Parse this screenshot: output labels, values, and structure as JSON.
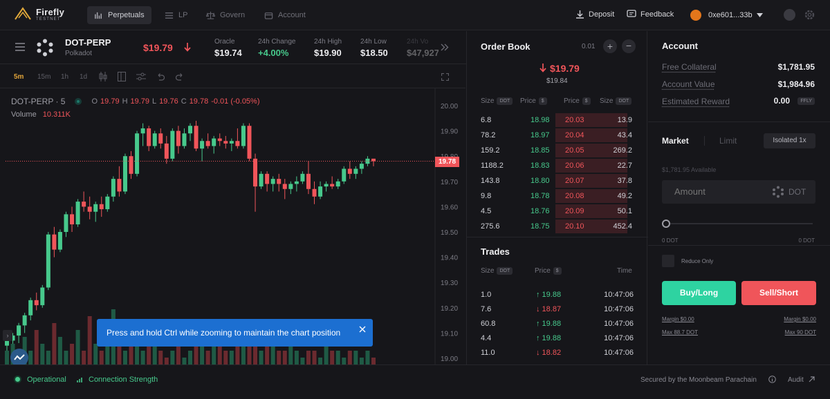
{
  "app": {
    "name": "Firefly",
    "tag": "TESTNET"
  },
  "nav": {
    "items": [
      {
        "label": "Perpetuals",
        "icon": "perpetuals-icon",
        "active": true
      },
      {
        "label": "LP",
        "icon": "lp-icon",
        "active": false
      },
      {
        "label": "Govern",
        "icon": "govern-icon",
        "active": false
      },
      {
        "label": "Account",
        "icon": "account-icon",
        "active": false
      }
    ],
    "deposit": "Deposit",
    "feedback": "Feedback",
    "wallet": "0xe601...33b"
  },
  "market": {
    "symbol": "DOT-PERP",
    "name": "Polkadot",
    "price": "$19.79",
    "stats": [
      {
        "label": "Oracle",
        "value": "$19.74"
      },
      {
        "label": "24h Change",
        "value": "+4.00%"
      },
      {
        "label": "24h High",
        "value": "$19.90"
      },
      {
        "label": "24h Low",
        "value": "$18.50"
      },
      {
        "label": "24h Vo",
        "value": "$47,927"
      }
    ]
  },
  "chart_toolbar": {
    "timeframes": [
      "5m",
      "15m",
      "1h",
      "1d"
    ],
    "active": "5m"
  },
  "chart": {
    "legend_symbol": "DOT-PERP · 5",
    "o": "19.79",
    "h": "19.79",
    "l": "19.76",
    "c": "19.78",
    "chg": "-0.01 (-0.05%)",
    "volume_label": "Volume",
    "volume_value": "10.311K",
    "last_price_tag": "19.78",
    "y_ticks": [
      "20.00",
      "19.90",
      "19.80",
      "19.70",
      "19.60",
      "19.50",
      "19.40",
      "19.30",
      "19.20",
      "19.10",
      "19.00"
    ]
  },
  "chart_data": {
    "type": "candlestick",
    "ylim": [
      19.0,
      20.0
    ],
    "series": [
      {
        "o": 19.05,
        "h": 19.08,
        "l": 19.0,
        "c": 19.07
      },
      {
        "o": 19.07,
        "h": 19.1,
        "l": 19.03,
        "c": 19.09
      },
      {
        "o": 19.09,
        "h": 19.14,
        "l": 19.06,
        "c": 19.13
      },
      {
        "o": 19.13,
        "h": 19.18,
        "l": 19.1,
        "c": 19.17
      },
      {
        "o": 19.17,
        "h": 19.24,
        "l": 19.15,
        "c": 19.23
      },
      {
        "o": 19.23,
        "h": 19.26,
        "l": 19.19,
        "c": 19.21
      },
      {
        "o": 19.21,
        "h": 19.29,
        "l": 19.2,
        "c": 19.28
      },
      {
        "o": 19.28,
        "h": 19.5,
        "l": 19.27,
        "c": 19.49
      },
      {
        "o": 19.49,
        "h": 19.52,
        "l": 19.4,
        "c": 19.43
      },
      {
        "o": 19.43,
        "h": 19.51,
        "l": 19.42,
        "c": 19.5
      },
      {
        "o": 19.5,
        "h": 19.58,
        "l": 19.48,
        "c": 19.57
      },
      {
        "o": 19.57,
        "h": 19.6,
        "l": 19.5,
        "c": 19.53
      },
      {
        "o": 19.53,
        "h": 19.63,
        "l": 19.52,
        "c": 19.62
      },
      {
        "o": 19.62,
        "h": 19.66,
        "l": 19.58,
        "c": 19.6
      },
      {
        "o": 19.6,
        "h": 19.64,
        "l": 19.55,
        "c": 19.58
      },
      {
        "o": 19.58,
        "h": 19.62,
        "l": 19.54,
        "c": 19.61
      },
      {
        "o": 19.61,
        "h": 19.64,
        "l": 19.56,
        "c": 19.59
      },
      {
        "o": 19.59,
        "h": 19.65,
        "l": 19.58,
        "c": 19.64
      },
      {
        "o": 19.64,
        "h": 19.72,
        "l": 19.62,
        "c": 19.71
      },
      {
        "o": 19.71,
        "h": 19.76,
        "l": 19.64,
        "c": 19.66
      },
      {
        "o": 19.66,
        "h": 19.81,
        "l": 19.65,
        "c": 19.8
      },
      {
        "o": 19.8,
        "h": 19.82,
        "l": 19.71,
        "c": 19.73
      },
      {
        "o": 19.73,
        "h": 19.9,
        "l": 19.72,
        "c": 19.89
      },
      {
        "o": 19.89,
        "h": 19.93,
        "l": 19.84,
        "c": 19.91
      },
      {
        "o": 19.91,
        "h": 19.92,
        "l": 19.82,
        "c": 19.84
      },
      {
        "o": 19.84,
        "h": 19.9,
        "l": 19.83,
        "c": 19.89
      },
      {
        "o": 19.89,
        "h": 19.91,
        "l": 19.83,
        "c": 19.85
      },
      {
        "o": 19.85,
        "h": 19.88,
        "l": 19.77,
        "c": 19.79
      },
      {
        "o": 19.79,
        "h": 19.91,
        "l": 19.78,
        "c": 19.9
      },
      {
        "o": 19.9,
        "h": 19.92,
        "l": 19.81,
        "c": 19.84
      },
      {
        "o": 19.84,
        "h": 19.91,
        "l": 19.83,
        "c": 19.89
      },
      {
        "o": 19.89,
        "h": 19.93,
        "l": 19.86,
        "c": 19.92
      },
      {
        "o": 19.92,
        "h": 19.94,
        "l": 19.82,
        "c": 19.83
      },
      {
        "o": 19.83,
        "h": 19.87,
        "l": 19.78,
        "c": 19.86
      },
      {
        "o": 19.86,
        "h": 19.89,
        "l": 19.83,
        "c": 19.84
      },
      {
        "o": 19.84,
        "h": 19.88,
        "l": 19.81,
        "c": 19.87
      },
      {
        "o": 19.87,
        "h": 19.89,
        "l": 19.84,
        "c": 19.86
      },
      {
        "o": 19.86,
        "h": 19.88,
        "l": 19.83,
        "c": 19.85
      },
      {
        "o": 19.85,
        "h": 19.87,
        "l": 19.82,
        "c": 19.86
      },
      {
        "o": 19.86,
        "h": 19.91,
        "l": 19.83,
        "c": 19.84
      },
      {
        "o": 19.84,
        "h": 19.93,
        "l": 19.83,
        "c": 19.92
      },
      {
        "o": 19.92,
        "h": 19.93,
        "l": 19.78,
        "c": 19.79
      },
      {
        "o": 19.79,
        "h": 19.81,
        "l": 19.58,
        "c": 19.68
      },
      {
        "o": 19.68,
        "h": 19.74,
        "l": 19.67,
        "c": 19.73
      },
      {
        "o": 19.73,
        "h": 19.74,
        "l": 19.66,
        "c": 19.69
      },
      {
        "o": 19.69,
        "h": 19.72,
        "l": 19.66,
        "c": 19.71
      },
      {
        "o": 19.71,
        "h": 19.73,
        "l": 19.66,
        "c": 19.69
      },
      {
        "o": 19.69,
        "h": 19.71,
        "l": 19.63,
        "c": 19.67
      },
      {
        "o": 19.67,
        "h": 19.7,
        "l": 19.65,
        "c": 19.69
      },
      {
        "o": 19.69,
        "h": 19.72,
        "l": 19.66,
        "c": 19.7
      },
      {
        "o": 19.7,
        "h": 19.74,
        "l": 19.69,
        "c": 19.73
      },
      {
        "o": 19.73,
        "h": 19.78,
        "l": 19.65,
        "c": 19.67
      },
      {
        "o": 19.67,
        "h": 19.7,
        "l": 19.61,
        "c": 19.64
      },
      {
        "o": 19.64,
        "h": 19.7,
        "l": 19.63,
        "c": 19.68
      },
      {
        "o": 19.68,
        "h": 19.7,
        "l": 19.66,
        "c": 19.69
      },
      {
        "o": 19.69,
        "h": 19.72,
        "l": 19.67,
        "c": 19.68
      },
      {
        "o": 19.68,
        "h": 19.71,
        "l": 19.67,
        "c": 19.7
      },
      {
        "o": 19.7,
        "h": 19.76,
        "l": 19.69,
        "c": 19.75
      },
      {
        "o": 19.75,
        "h": 19.78,
        "l": 19.71,
        "c": 19.73
      },
      {
        "o": 19.73,
        "h": 19.76,
        "l": 19.71,
        "c": 19.75
      },
      {
        "o": 19.75,
        "h": 19.78,
        "l": 19.73,
        "c": 19.77
      },
      {
        "o": 19.77,
        "h": 19.8,
        "l": 19.76,
        "c": 19.79
      },
      {
        "o": 19.79,
        "h": 19.79,
        "l": 19.76,
        "c": 19.78
      }
    ]
  },
  "orderbook": {
    "title": "Order Book",
    "tick": "0.01",
    "mid_price": "$19.79",
    "mark_price": "$19.84",
    "headers": {
      "size": "Size",
      "size_unit": "DOT",
      "price": "Price",
      "price_unit": "$"
    },
    "bids": [
      {
        "size": "6.8",
        "price": "18.98"
      },
      {
        "size": "78.2",
        "price": "18.97"
      },
      {
        "size": "159.2",
        "price": "18.85"
      },
      {
        "size": "1188.2",
        "price": "18.83"
      },
      {
        "size": "143.8",
        "price": "18.80"
      },
      {
        "size": "9.8",
        "price": "18.78"
      },
      {
        "size": "4.5",
        "price": "18.76"
      },
      {
        "size": "275.6",
        "price": "18.75"
      }
    ],
    "asks": [
      {
        "price": "20.03",
        "size": "13.9"
      },
      {
        "price": "20.04",
        "size": "43.4"
      },
      {
        "price": "20.05",
        "size": "269.2"
      },
      {
        "price": "20.06",
        "size": "22.7"
      },
      {
        "price": "20.07",
        "size": "37.8"
      },
      {
        "price": "20.08",
        "size": "49.2"
      },
      {
        "price": "20.09",
        "size": "50.1"
      },
      {
        "price": "20.10",
        "size": "452.4"
      }
    ]
  },
  "trades": {
    "title": "Trades",
    "headers": {
      "size": "Size",
      "size_unit": "DOT",
      "price": "Price",
      "price_unit": "$",
      "time": "Time"
    },
    "rows": [
      {
        "size": "1.0",
        "price": "19.88",
        "dir": "up",
        "time": "10:47:06"
      },
      {
        "size": "7.6",
        "price": "18.87",
        "dir": "down",
        "time": "10:47:06"
      },
      {
        "size": "60.8",
        "price": "19.88",
        "dir": "up",
        "time": "10:47:06"
      },
      {
        "size": "4.4",
        "price": "19.88",
        "dir": "up",
        "time": "10:47:06"
      },
      {
        "size": "11.0",
        "price": "18.82",
        "dir": "down",
        "time": "10:47:06"
      }
    ]
  },
  "account": {
    "title": "Account",
    "rows": [
      {
        "label": "Free Collateral",
        "value": "$1,781.95"
      },
      {
        "label": "Account Value",
        "value": "$1,984.96"
      },
      {
        "label": "Estimated Reward",
        "value": "0.00",
        "badge": "FFLY"
      }
    ]
  },
  "order_form": {
    "tab_market": "Market",
    "tab_limit": "Limit",
    "margin_mode": "Isolated 1x",
    "available": "$1,781.95 Available",
    "amount_placeholder": "Amount",
    "amount_unit": "DOT",
    "slider_min": "0 DOT",
    "slider_max": "0 DOT",
    "reduce_only": "Reduce Only",
    "buy_label": "Buy/Long",
    "sell_label": "Sell/Short",
    "buy_margin": "Margin $0.00",
    "buy_max": "Max 88.7 DOT",
    "sell_margin": "Margin $0.00",
    "sell_max": "Max 90 DOT"
  },
  "toast": {
    "text": "Press and hold Ctrl while zooming to maintain the chart position"
  },
  "footer": {
    "status": "Operational",
    "connection": "Connection Strength",
    "secured": "Secured by the Moonbeam Parachain",
    "audit": "Audit"
  },
  "colors": {
    "up": "#47c98c",
    "down": "#f0555a",
    "bg": "#16161a",
    "accent_blue": "#1c6fd1"
  }
}
